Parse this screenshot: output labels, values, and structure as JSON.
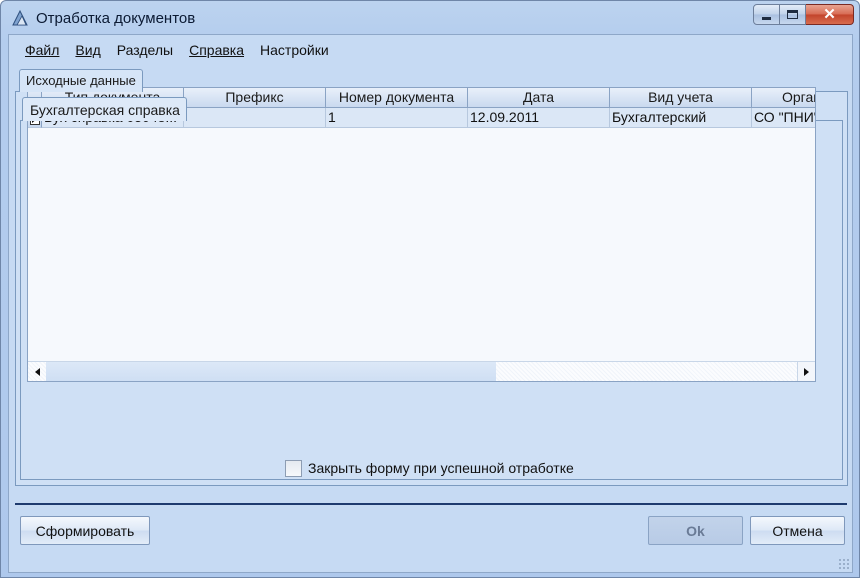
{
  "window": {
    "title": "Отработка документов",
    "icon": "app-icon",
    "controls": {
      "minimize": "minimize-icon",
      "maximize": "maximize-icon",
      "close": "close-icon"
    }
  },
  "menu": [
    {
      "label": "Файл"
    },
    {
      "label": "Вид"
    },
    {
      "label": "Разделы"
    },
    {
      "label": "Справка"
    },
    {
      "label": "Настройки"
    }
  ],
  "tabs": {
    "outer": "Исходные данные",
    "inner": "Бухгалтерская справка"
  },
  "grid": {
    "columns": [
      "Тип документа",
      "Префикс",
      "Номер документа",
      "Дата",
      "Вид учета",
      "Орган"
    ],
    "rows": [
      [
        "Бух справка 05048...",
        "",
        "1",
        "12.09.2011",
        "Бухгалтерский",
        "СО \"ПНИ\""
      ]
    ]
  },
  "checkbox": {
    "label": "Закрыть форму при успешной отработке",
    "checked": false
  },
  "buttons": {
    "form": "Сформировать",
    "ok": "Ok",
    "cancel": "Отмена"
  },
  "colors": {
    "window_bg": "#b4cdee",
    "client_bg": "#c6daf3",
    "grid_row_bg": "#dbe7f6",
    "divider": "#1e3a6e",
    "close_button": "#c2432b"
  }
}
